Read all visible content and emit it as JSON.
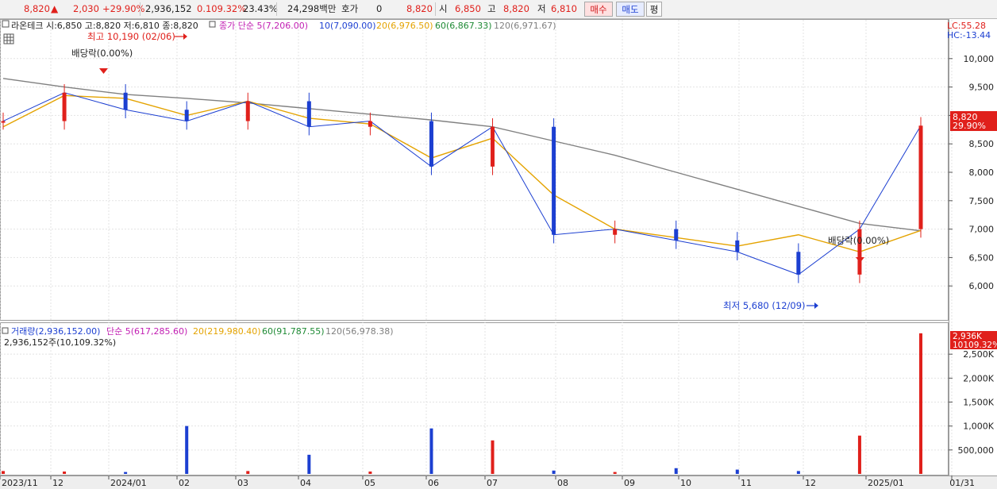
{
  "quote_bar": {
    "price": "8,820",
    "change": "2,030",
    "change_pct": "+29.90%",
    "volume": "2,936,152",
    "volume_ratio": "0.109.32%",
    "turnover_rate": "23.43%",
    "trade_value": "24,298백만",
    "bid_label": "호가",
    "bid_value": "0",
    "bid_price": "8,820",
    "open_label": "시",
    "open": "6,850",
    "high_label": "고",
    "high": "8,820",
    "low_label": "저",
    "low": "6,810",
    "buy_label": "매수",
    "sell_label": "매도",
    "extra_label": "평"
  },
  "price_panel": {
    "info": "라온테크 시:6,850 고:8,820 저:6,810 종:8,820",
    "ma_legend": [
      {
        "text": "종가 단순 5(7,206.00)",
        "color": "#c21fb3"
      },
      {
        "text": "10(7,090.00)",
        "color": "#1c3fd1"
      },
      {
        "text": "20(6,976.50)",
        "color": "#e4a300"
      },
      {
        "text": "60(6,867.33)",
        "color": "#1e8a34"
      },
      {
        "text": "120(6,971.67)",
        "color": "#808080"
      }
    ],
    "lc": "LC:55.28",
    "hc": "HC:-13.44",
    "current_price": "8,820",
    "current_pct": "29.90%",
    "annotations": {
      "high": "최고 10,190 (02/06)",
      "low": "최저 5,680 (12/09)",
      "dividend_1": "배당락(0.00%)",
      "dividend_2": "배당락(0.00%)"
    }
  },
  "volume_panel": {
    "legend": [
      {
        "text": "거래량(2,936,152.00)",
        "color": "#1c3fd1"
      },
      {
        "text": "단순 5(617,285.60)",
        "color": "#c21fb3"
      },
      {
        "text": "20(219,980.40)",
        "color": "#e4a300"
      },
      {
        "text": "60(91,787.55)",
        "color": "#1e8a34"
      },
      {
        "text": "120(56,978.38)",
        "color": "#808080"
      }
    ],
    "info": "2,936,152주(10,109.32%)",
    "current_volume": "2,936K",
    "current_volume_pct": "10109.32%"
  },
  "chart_data": [
    {
      "type": "line",
      "title": "라온테크",
      "x_ticks": [
        "2023/11",
        "12",
        "2024/01",
        "02",
        "03",
        "04",
        "05",
        "06",
        "07",
        "08",
        "09",
        "10",
        "11",
        "12",
        "2025/01",
        "01/31"
      ],
      "y_ticks": [
        6000,
        6500,
        7000,
        7500,
        8000,
        8500,
        9000,
        9500,
        10000
      ],
      "y_tick_labels": [
        "6,000",
        "6,500",
        "7,000",
        "7,500",
        "8,000",
        "8,500",
        "9,000",
        "9,500",
        "10,000"
      ],
      "ylim": [
        5500,
        10500
      ],
      "series": [
        {
          "name": "종가",
          "color": "#1c3fd1",
          "x": [
            "2023/11",
            "12",
            "2024/01",
            "02",
            "03",
            "04",
            "05",
            "06",
            "07",
            "08",
            "09",
            "10",
            "11",
            "12",
            "2025/01",
            "01/31"
          ],
          "values": [
            8900,
            9400,
            9100,
            8900,
            9250,
            8800,
            8900,
            8100,
            8800,
            6900,
            7000,
            6800,
            6600,
            6200,
            7000,
            8820
          ]
        },
        {
          "name": "120",
          "color": "#808080",
          "x": [
            "2023/11",
            "12",
            "2024/01",
            "02",
            "03",
            "04",
            "05",
            "06",
            "07",
            "08",
            "09",
            "10",
            "11",
            "12",
            "2025/01",
            "01/31"
          ],
          "values": [
            9650,
            9500,
            9370,
            9300,
            9220,
            9120,
            9020,
            8920,
            8800,
            8550,
            8300,
            8000,
            7700,
            7400,
            7100,
            6970
          ]
        },
        {
          "name": "20",
          "color": "#e4a300",
          "x": [
            "2023/11",
            "12",
            "2024/01",
            "02",
            "03",
            "04",
            "05",
            "06",
            "07",
            "08",
            "09",
            "10",
            "11",
            "12",
            "2025/01",
            "01/31"
          ],
          "values": [
            8800,
            9350,
            9300,
            9000,
            9250,
            8950,
            8850,
            8250,
            8600,
            7600,
            7000,
            6850,
            6700,
            6900,
            6600,
            6976
          ]
        }
      ]
    },
    {
      "type": "bar",
      "title": "거래량",
      "y_ticks": [
        500000,
        1000000,
        1500000,
        2000000,
        2500000
      ],
      "y_tick_labels": [
        "500,000",
        "1,000K",
        "1,500K",
        "2,000K",
        "2,500K"
      ],
      "ylim": [
        0,
        3000000
      ],
      "categories": [
        "2023/11",
        "12",
        "2024/01",
        "02",
        "03",
        "04",
        "05",
        "06",
        "07",
        "08",
        "09",
        "10",
        "11",
        "12",
        "2025/01",
        "01/31"
      ],
      "values": [
        60000,
        50000,
        40000,
        1000000,
        60000,
        400000,
        50000,
        950000,
        700000,
        70000,
        40000,
        120000,
        90000,
        60000,
        800000,
        2936152
      ]
    }
  ]
}
